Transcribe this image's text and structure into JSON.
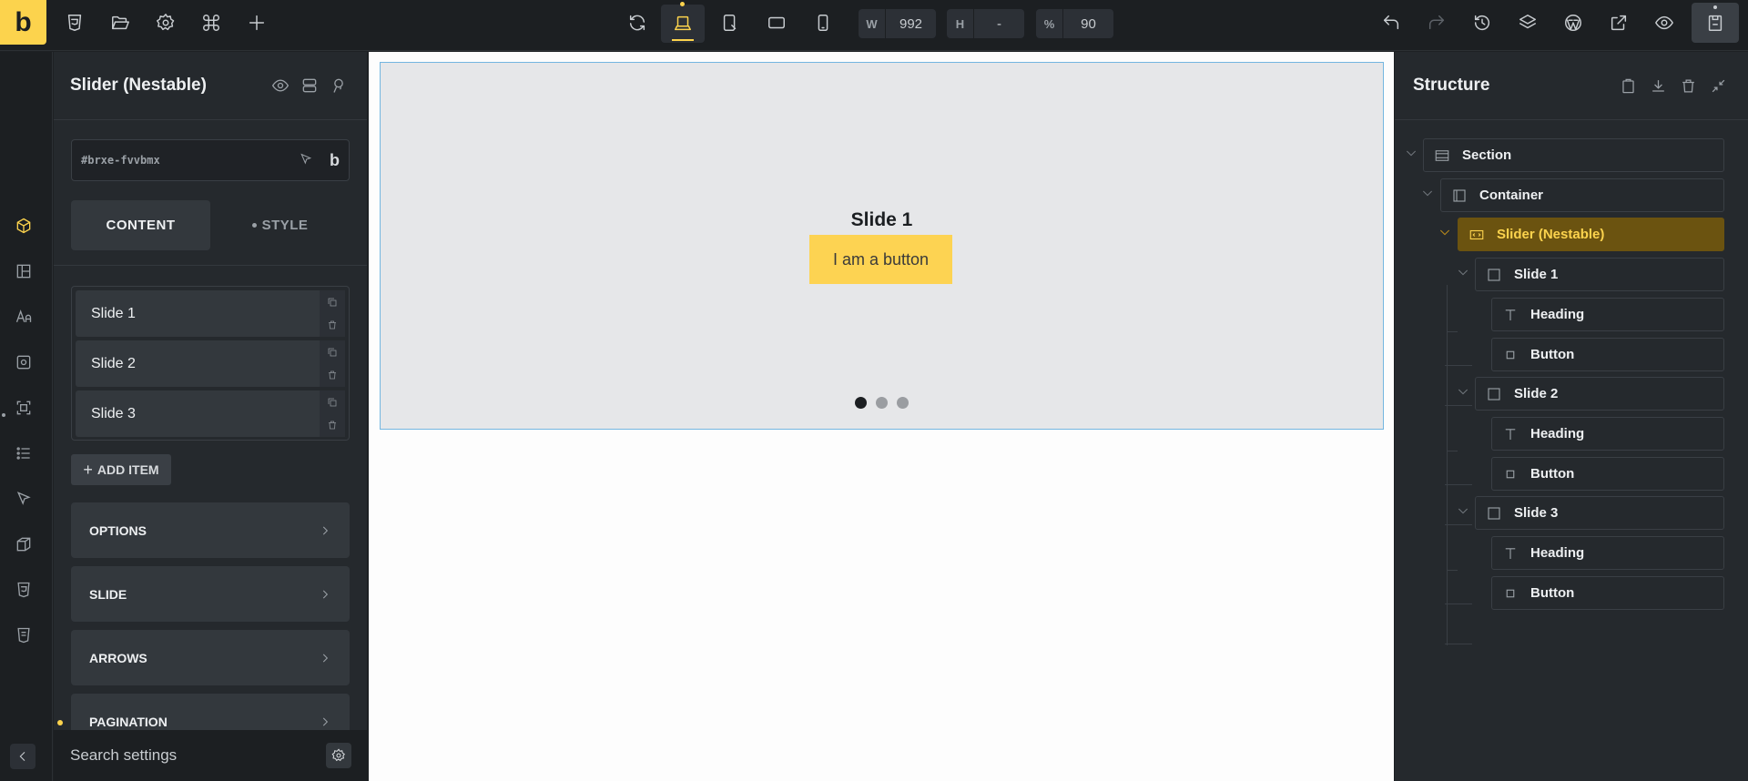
{
  "app": {
    "logo_letter": "b",
    "accent_color": "#fcd34d"
  },
  "toolbar": {
    "width_label": "W",
    "width_value": "992",
    "height_label": "H",
    "height_value": "-",
    "zoom_label": "%",
    "zoom_value": "90"
  },
  "panel": {
    "title": "Slider (Nestable)",
    "element_id": "#brxe-fvvbmx",
    "builder_letter": "b",
    "tabs": [
      {
        "label": "CONTENT",
        "active": true
      },
      {
        "label": "STYLE",
        "active": false
      }
    ],
    "items": [
      {
        "label": "Slide 1"
      },
      {
        "label": "Slide 2"
      },
      {
        "label": "Slide 3"
      }
    ],
    "add_item_label": "ADD ITEM",
    "sections": [
      {
        "label": "OPTIONS"
      },
      {
        "label": "SLIDE"
      },
      {
        "label": "ARROWS"
      },
      {
        "label": "PAGINATION"
      }
    ],
    "search_placeholder": "Search settings"
  },
  "canvas": {
    "slide_heading": "Slide 1",
    "slide_button": "I am a button",
    "pagination_count": 3,
    "active_slide": 1
  },
  "structure": {
    "title": "Structure",
    "nodes": [
      {
        "label": "Section",
        "icon": "section-icon"
      },
      {
        "label": "Container",
        "icon": "container-icon"
      },
      {
        "label": "Slider (Nestable)",
        "icon": "slider-icon",
        "selected": true
      },
      {
        "label": "Slide 1",
        "icon": "block-icon"
      },
      {
        "label": "Heading",
        "icon": "heading-icon"
      },
      {
        "label": "Button",
        "icon": "button-icon"
      },
      {
        "label": "Slide 2",
        "icon": "block-icon"
      },
      {
        "label": "Heading",
        "icon": "heading-icon"
      },
      {
        "label": "Button",
        "icon": "button-icon"
      },
      {
        "label": "Slide 3",
        "icon": "block-icon"
      },
      {
        "label": "Heading",
        "icon": "heading-icon"
      },
      {
        "label": "Button",
        "icon": "button-icon"
      }
    ]
  }
}
